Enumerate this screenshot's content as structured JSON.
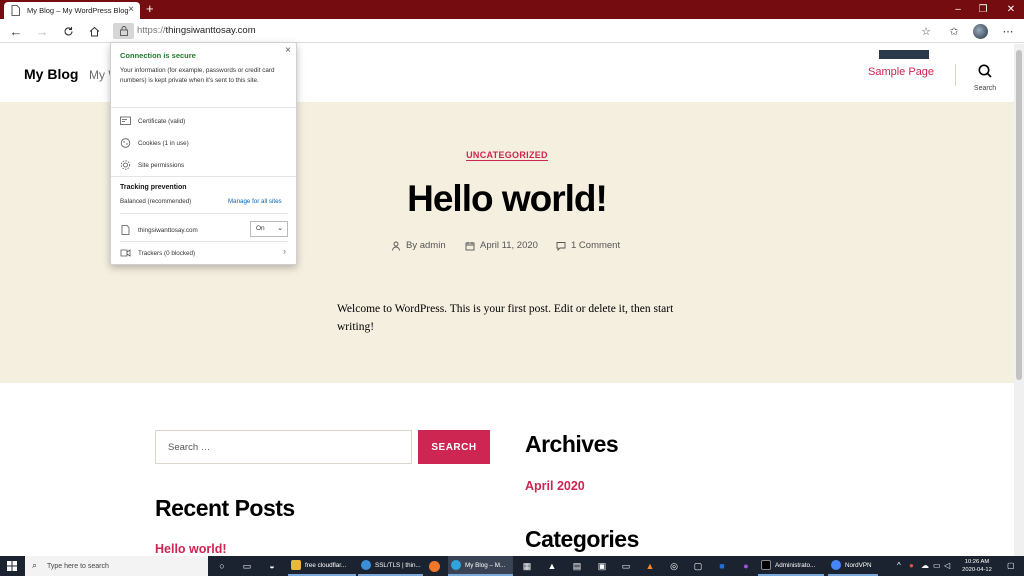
{
  "browser": {
    "tab_title": "My Blog – My WordPress Blog",
    "tab_close": "×",
    "new_tab": "+",
    "window": {
      "minimize": "–",
      "restore": "❐",
      "close": "✕"
    },
    "url_protocol": "https://",
    "url_host": "thingsiwanttosay.com"
  },
  "site": {
    "title": "My Blog",
    "description_fragment": "My W",
    "menu_item": "Sample Page",
    "search_label": "Search"
  },
  "post": {
    "category": "UNCATEGORIZED",
    "title": "Hello world!",
    "author": "By admin",
    "date": "April 11, 2020",
    "comments": "1 Comment",
    "body": "Welcome to WordPress. This is your first post. Edit or delete it, then start writing!"
  },
  "widgets": {
    "search_placeholder": "Search …",
    "search_button": "SEARCH",
    "archives_heading": "Archives",
    "archive_link": "April 2020",
    "recent_heading": "Recent Posts",
    "recent_link": "Hello world!",
    "categories_heading": "Categories"
  },
  "popup": {
    "close": "×",
    "status": "Connection is secure",
    "info": "Your information (for example, passwords or credit card numbers) is kept private when it's sent to this site.",
    "certificate": "Certificate (valid)",
    "cookies": "Cookies (1 in use)",
    "permissions": "Site permissions",
    "tracking_title": "Tracking prevention",
    "tracking_level": "Balanced (recommended)",
    "manage_link": "Manage for all sites",
    "site_name": "thingsiwanttosay.com",
    "toggle_value": "On",
    "trackers": "Trackers (0 blocked)"
  },
  "taskbar": {
    "search_placeholder": "Type here to search",
    "apps": [
      "free cloudflar...",
      "SSL/TLS | thin...",
      "My Blog – M...",
      "Administrato...",
      "NordVPN"
    ],
    "time": "10:26 AM",
    "date": "2020-04-12"
  },
  "colors": {
    "accent": "#cd2653",
    "hero_bg": "#f5efe0",
    "titlebar": "#750c10",
    "secure_green": "#1f7b2c"
  }
}
